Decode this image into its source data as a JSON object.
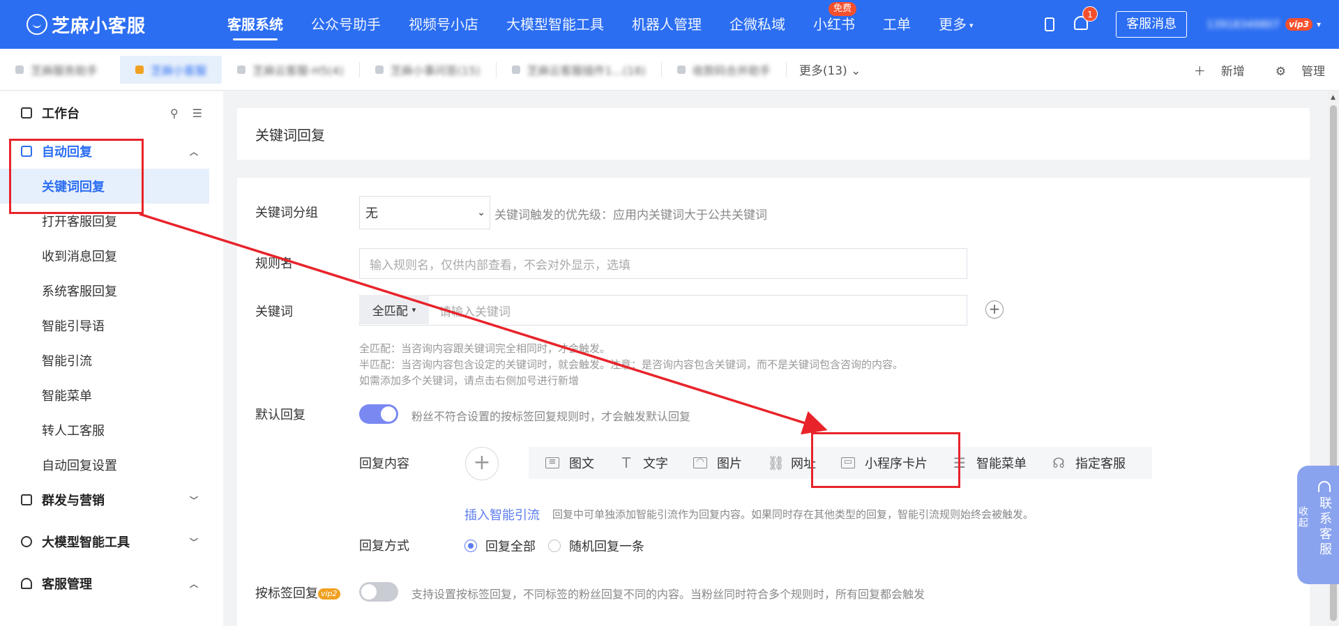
{
  "header": {
    "brand": "芝麻小客服",
    "nav": [
      {
        "label": "客服系统",
        "active": true
      },
      {
        "label": "公众号助手"
      },
      {
        "label": "视频号小店"
      },
      {
        "label": "大模型智能工具"
      },
      {
        "label": "机器人管理"
      },
      {
        "label": "企微私域"
      },
      {
        "label": "小红书",
        "badge": "免费"
      },
      {
        "label": "工单"
      },
      {
        "label": "更多"
      }
    ],
    "notification_count": "1",
    "message_button": "客服消息",
    "account_name": "13918349807",
    "vip_badge": "vip3"
  },
  "tabs": {
    "items": [
      {
        "label": "芝麻服务助手"
      },
      {
        "label": "芝麻小客服",
        "active": true
      },
      {
        "label": "芝麻云客服-H5(4)"
      },
      {
        "label": "芝麻小事问答(15)"
      },
      {
        "label": "芝麻云客服插件1...(18)"
      },
      {
        "label": "收款码合并助手"
      }
    ],
    "more": "更多(13)",
    "add": "新增",
    "manage": "管理"
  },
  "sidebar": {
    "workbench": "工作台",
    "auto_reply": "自动回复",
    "items": [
      {
        "label": "关键词回复",
        "active": true
      },
      {
        "label": "打开客服回复"
      },
      {
        "label": "收到消息回复"
      },
      {
        "label": "系统客服回复"
      },
      {
        "label": "智能引导语"
      },
      {
        "label": "智能引流"
      },
      {
        "label": "智能菜单"
      },
      {
        "label": "转人工客服"
      },
      {
        "label": "自动回复设置"
      }
    ],
    "groups": [
      {
        "label": "群发与营销"
      },
      {
        "label": "大模型智能工具"
      },
      {
        "label": "客服管理"
      }
    ]
  },
  "main": {
    "title": "关键词回复",
    "keyword_group_label": "关键词分组",
    "keyword_group_value": "无",
    "keyword_group_hint": "关键词触发的优先级：应用内关键词大于公共关键词",
    "rule_name_label": "规则名",
    "rule_name_placeholder": "输入规则名，仅供内部查看，不会对外显示，选填",
    "keyword_label": "关键词",
    "match_mode": "全匹配",
    "keyword_placeholder": "请输入关键词",
    "hint_lines": [
      "全匹配：当咨询内容跟关键词完全相同时，才会触发。",
      "半匹配：当咨询内容包含设定的关键词时，就会触发。注意：是咨询内容包含关键词，而不是关键词包含咨询的内容。",
      "如需添加多个关键词，请点击右侧加号进行新增"
    ],
    "default_reply_label": "默认回复",
    "default_reply_hint": "粉丝不符合设置的按标签回复规则时，才会触发默认回复",
    "reply_content_label": "回复内容",
    "content_types": [
      {
        "label": "图文",
        "icon": "article-icon"
      },
      {
        "label": "文字",
        "icon": "text-icon"
      },
      {
        "label": "图片",
        "icon": "image-icon"
      },
      {
        "label": "网址",
        "icon": "link-icon"
      },
      {
        "label": "小程序卡片",
        "icon": "miniprogram-card-icon"
      },
      {
        "label": "智能菜单",
        "icon": "menu-icon"
      },
      {
        "label": "指定客服",
        "icon": "headset-icon"
      }
    ],
    "insert_link": "插入智能引流",
    "insert_hint": "回复中可单独添加智能引流作为回复内容。如果同时存在其他类型的回复，智能引流规则始终会被触发。",
    "reply_mode_label": "回复方式",
    "reply_all": "回复全部",
    "reply_random": "随机回复一条",
    "tag_reply_label": "按标签回复",
    "tag_reply_vip": "vip2",
    "tag_reply_hint": "支持设置按标签回复，不同标签的粉丝回复不同的内容。当粉丝同时符合多个规则时，所有回复都会触发"
  },
  "float": {
    "collapse": "收起",
    "contact": "联系客服"
  },
  "colors": {
    "primary": "#2c6ef2",
    "annotation": "#e8232a",
    "toggle_on": "#7a88f2"
  }
}
